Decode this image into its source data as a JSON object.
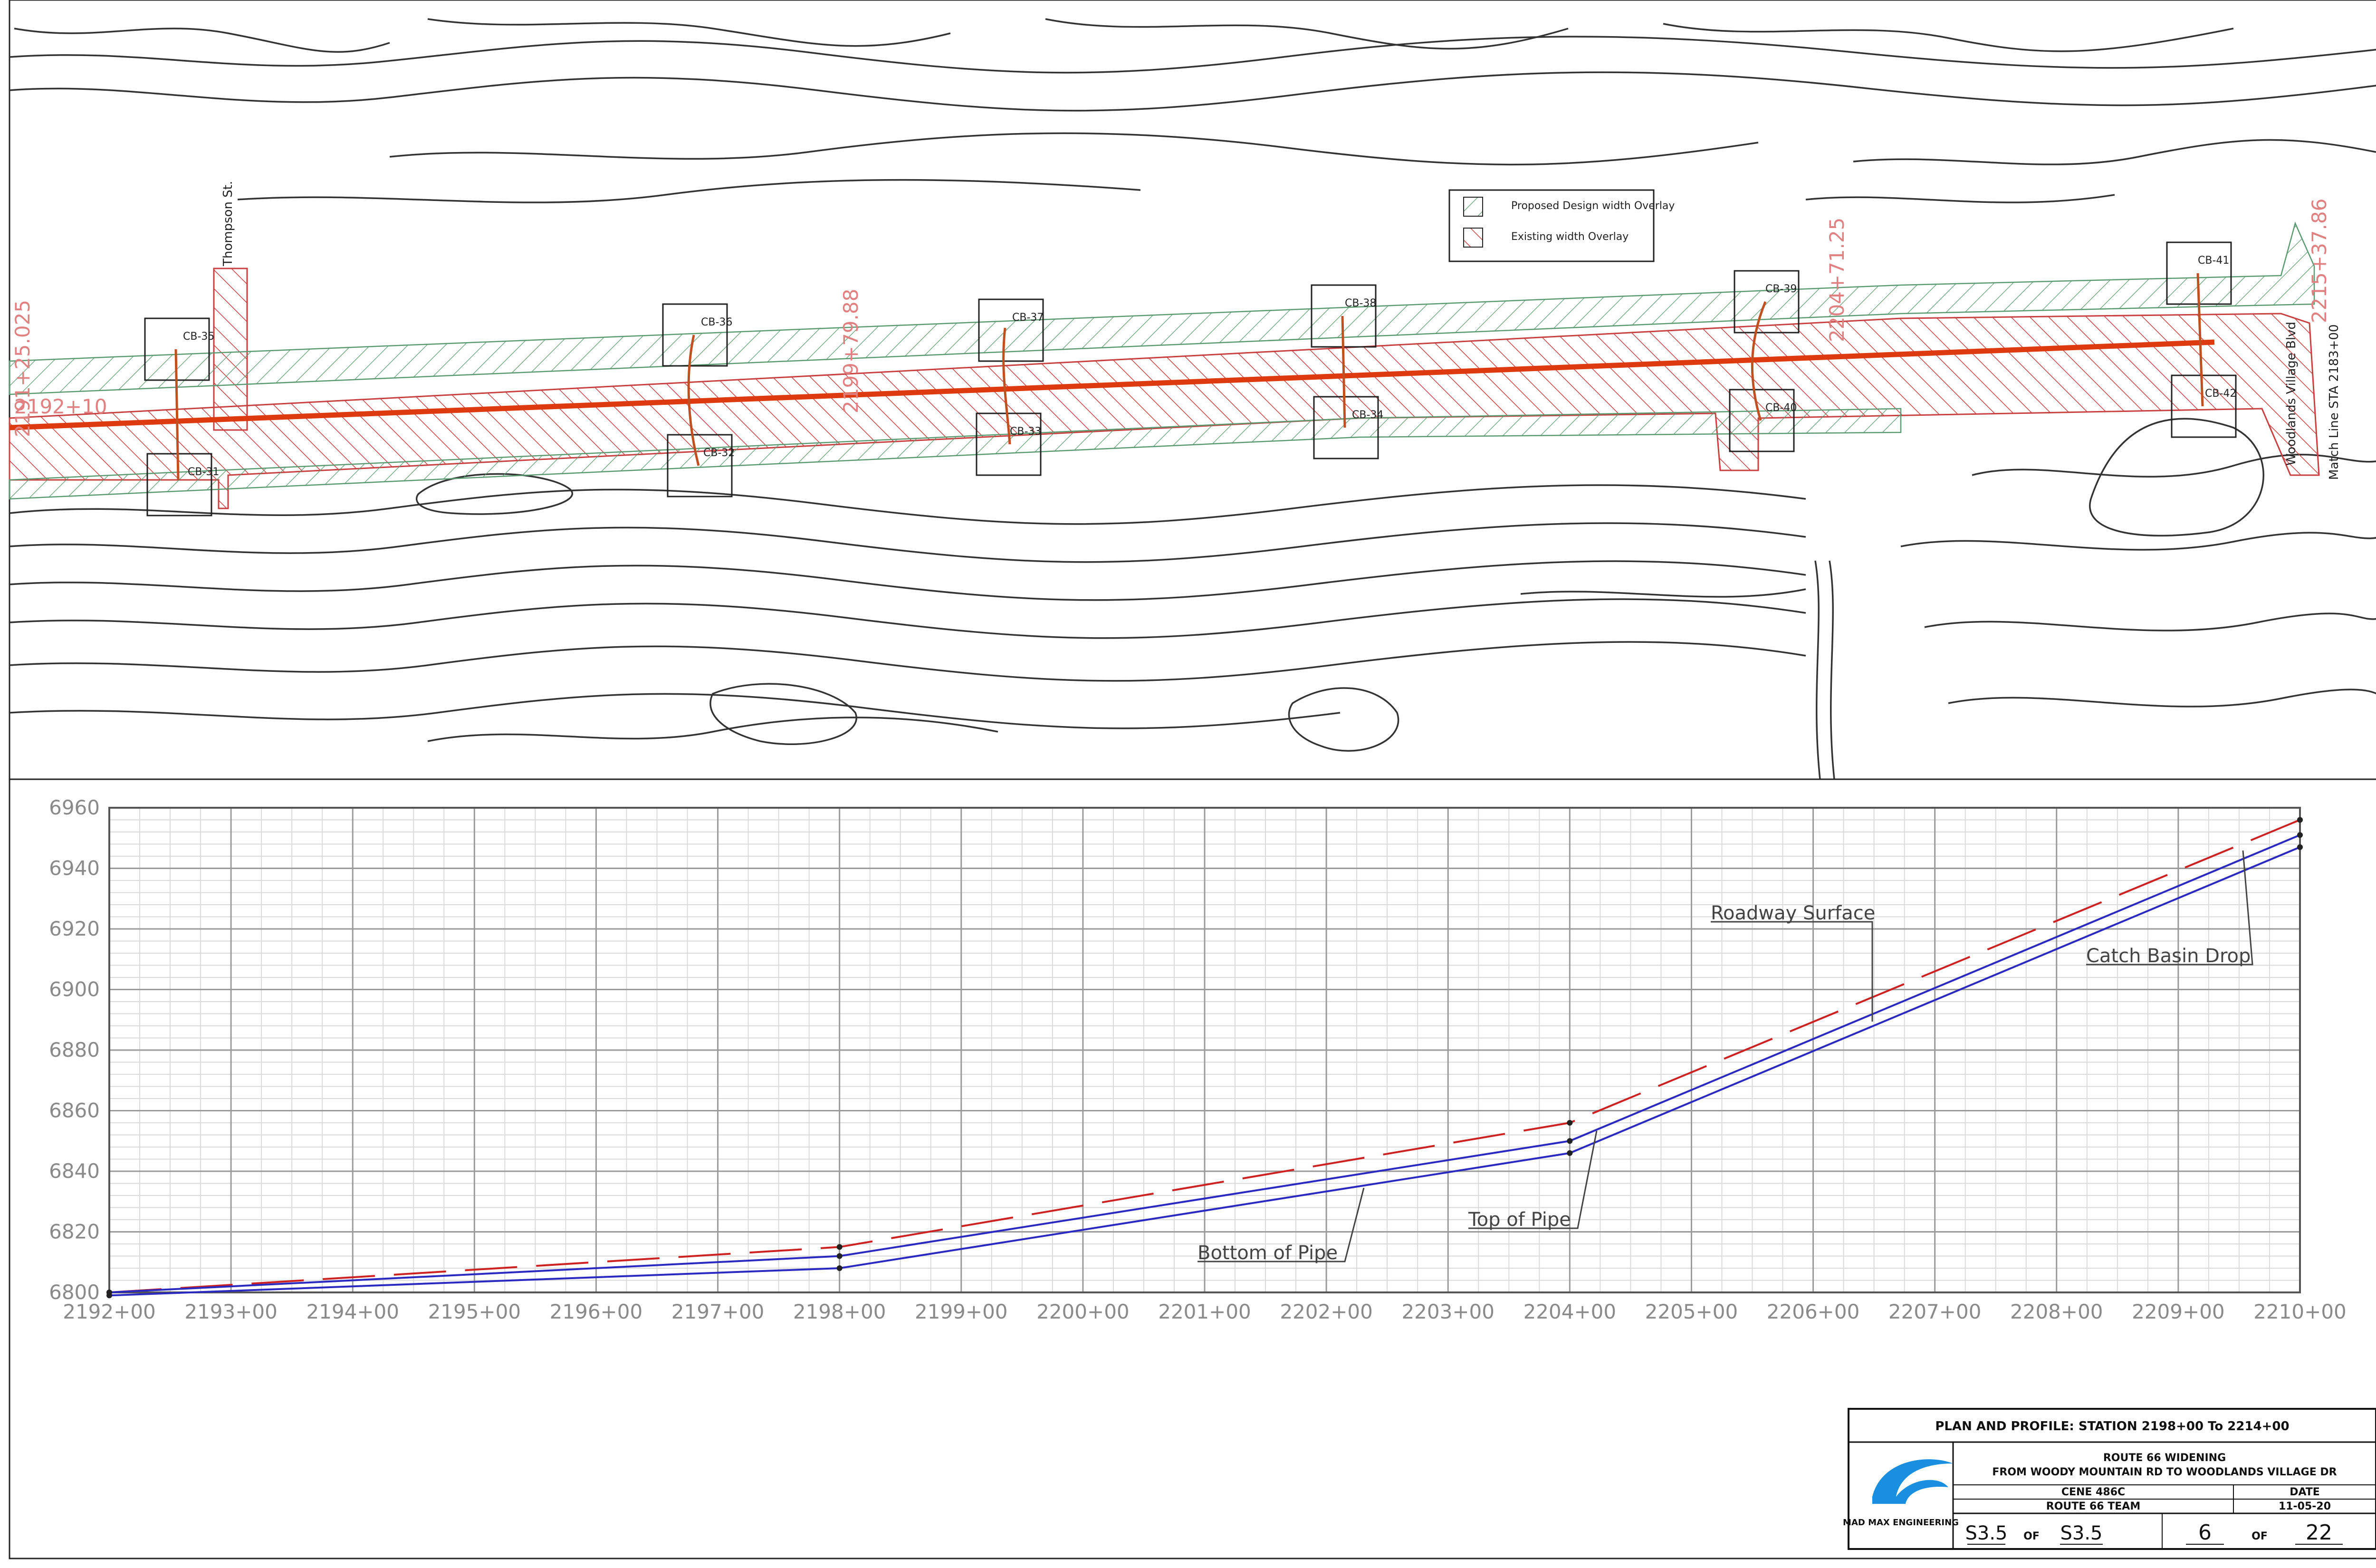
{
  "plan": {
    "legend": {
      "proposed": "Proposed Design width Overlay",
      "existing": "Existing width Overlay"
    },
    "street_labels": {
      "thompson": "Thompson St.",
      "woodlands": "Woodlands Village Blvd"
    },
    "match_line": "Match Line STA 2183+00",
    "station_labels": {
      "left_top": "2191+25.025",
      "left_mid": "2192+10",
      "mid": "2199+79.88",
      "right_mid": "2204+71.25",
      "right_top": "2215+37.86"
    },
    "catch_basins": [
      "CB-35",
      "CB-36",
      "CB-37",
      "CB-38",
      "CB-39",
      "CB-41",
      "CB-31",
      "CB-32",
      "CB-33",
      "CB-34",
      "CB-40",
      "CB-42"
    ]
  },
  "profile": {
    "annotations": {
      "roadway": "Roadway Surface",
      "catch_basin": "Catch Basin Drop",
      "top_pipe": "Top of Pipe",
      "bottom_pipe": "Bottom of Pipe"
    }
  },
  "chart_data": {
    "type": "line",
    "x_ticks": [
      "2192+00",
      "2193+00",
      "2194+00",
      "2195+00",
      "2196+00",
      "2197+00",
      "2198+00",
      "2199+00",
      "2200+00",
      "2201+00",
      "2202+00",
      "2203+00",
      "2204+00",
      "2205+00",
      "2206+00",
      "2207+00",
      "2208+00",
      "2209+00",
      "2210+00"
    ],
    "y_ticks": [
      6800,
      6820,
      6840,
      6860,
      6880,
      6900,
      6920,
      6940,
      6960
    ],
    "xlim": [
      2192,
      2210
    ],
    "ylim": [
      6800,
      6960
    ],
    "grid": true,
    "series": [
      {
        "name": "Roadway Surface",
        "color": "#cc2222",
        "dashed": true,
        "points": [
          [
            2192,
            6800
          ],
          [
            2198,
            6815
          ],
          [
            2204,
            6856
          ],
          [
            2210,
            6956
          ]
        ]
      },
      {
        "name": "Top of Pipe",
        "color": "#2a2ac0",
        "dashed": false,
        "points": [
          [
            2192,
            6800
          ],
          [
            2198,
            6812
          ],
          [
            2204,
            6850
          ],
          [
            2210,
            6951
          ]
        ]
      },
      {
        "name": "Bottom of Pipe",
        "color": "#2a2ac0",
        "dashed": false,
        "points": [
          [
            2192,
            6799
          ],
          [
            2198,
            6808
          ],
          [
            2204,
            6846
          ],
          [
            2210,
            6947
          ]
        ]
      }
    ]
  },
  "title_block": {
    "header": "PLAN AND PROFILE: STATION 2198+00 To 2214+00",
    "project_line1": "ROUTE 66 WIDENING",
    "project_line2": "FROM WOODY MOUNTAIN RD TO WOODLANDS VILLAGE DR",
    "course": "CENE 486C",
    "team": "ROUTE 66 TEAM",
    "date_label": "DATE",
    "date": "11-05-20",
    "company": "MAD MAX ENGINEERING",
    "sheet_id": "S3.5",
    "of_word": "OF",
    "sheet_id_total": "S3.5",
    "sheet_num": "6",
    "sheet_total": "22",
    "logo_color": "#1a8fe0"
  }
}
